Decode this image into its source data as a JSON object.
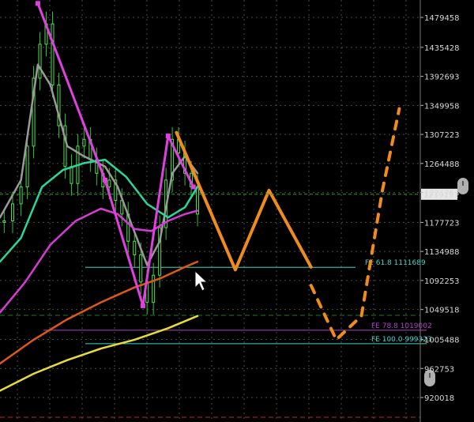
{
  "chart_data": {
    "type": "candlestick",
    "grid": true,
    "ylim": [
      900000,
      1520000
    ],
    "y_ticks": [
      {
        "label": "1479458",
        "value": 1479458
      },
      {
        "label": "1435428",
        "value": 1435428
      },
      {
        "label": "1392693",
        "value": 1392693
      },
      {
        "label": "1349958",
        "value": 1349958
      },
      {
        "label": "1307223",
        "value": 1307223
      },
      {
        "label": "1264488",
        "value": 1264488
      },
      {
        "label": "1221753",
        "value": 1221753
      },
      {
        "label": "1177723",
        "value": 1177723
      },
      {
        "label": "1134988",
        "value": 1134988
      },
      {
        "label": "1092253",
        "value": 1092253
      },
      {
        "label": "1049518",
        "value": 1049518
      },
      {
        "label": "1005488",
        "value": 1005488
      },
      {
        "label": "962753",
        "value": 962753
      },
      {
        "label": "920018",
        "value": 920018
      }
    ],
    "current_price": {
      "label": "1219151",
      "value": 1219151
    },
    "levels": [
      {
        "label": "FE 61.8 1111689",
        "value": 1111689,
        "color": "#3fd6c8"
      },
      {
        "label": "FE 78.8 1019002",
        "value": 1019002,
        "color": "#b040c8"
      },
      {
        "label": "FE 100.0 999323",
        "value": 999323,
        "color": "#3fd6c8"
      }
    ],
    "x_index_range": [
      0,
      100
    ],
    "candles": [
      {
        "x": 1,
        "close": 1180000
      },
      {
        "x": 3,
        "close": 1205000
      },
      {
        "x": 5,
        "close": 1230000
      },
      {
        "x": 6.5,
        "close": 1290000
      },
      {
        "x": 8,
        "close": 1390000
      },
      {
        "x": 9.5,
        "close": 1440000
      },
      {
        "x": 11,
        "close": 1470000
      },
      {
        "x": 12.5,
        "close": 1380000
      },
      {
        "x": 14,
        "close": 1320000
      },
      {
        "x": 15.5,
        "close": 1260000
      },
      {
        "x": 17,
        "close": 1235000
      },
      {
        "x": 18.5,
        "close": 1290000
      },
      {
        "x": 20,
        "close": 1300000
      },
      {
        "x": 21.5,
        "close": 1270000
      },
      {
        "x": 23,
        "close": 1250000
      },
      {
        "x": 24.5,
        "close": 1230000
      },
      {
        "x": 26,
        "close": 1240000
      },
      {
        "x": 27.5,
        "close": 1210000
      },
      {
        "x": 29,
        "close": 1190000
      },
      {
        "x": 30.5,
        "close": 1150000
      },
      {
        "x": 32,
        "close": 1130000
      },
      {
        "x": 33.5,
        "close": 1090000
      },
      {
        "x": 35,
        "close": 1060000
      },
      {
        "x": 36.5,
        "close": 1100000
      },
      {
        "x": 38,
        "close": 1170000
      },
      {
        "x": 39.5,
        "close": 1240000
      },
      {
        "x": 41,
        "close": 1300000
      },
      {
        "x": 42.5,
        "close": 1280000
      },
      {
        "x": 44,
        "close": 1250000
      },
      {
        "x": 45.5,
        "close": 1230000
      },
      {
        "x": 47,
        "close": 1190000
      }
    ],
    "series": [
      {
        "color": "#9a9a9a",
        "points": [
          [
            0,
            1185000
          ],
          [
            5,
            1240000
          ],
          [
            9,
            1410000
          ],
          [
            12,
            1380000
          ],
          [
            16,
            1290000
          ],
          [
            20,
            1275000
          ],
          [
            25,
            1260000
          ],
          [
            28,
            1230000
          ],
          [
            31,
            1180000
          ],
          [
            35,
            1115000
          ],
          [
            38,
            1150000
          ],
          [
            41,
            1250000
          ],
          [
            44,
            1275000
          ],
          [
            47,
            1250000
          ]
        ]
      },
      {
        "color": "#27d7a0",
        "points": [
          [
            0,
            1120000
          ],
          [
            5,
            1155000
          ],
          [
            10,
            1230000
          ],
          [
            15,
            1255000
          ],
          [
            20,
            1265000
          ],
          [
            25,
            1270000
          ],
          [
            30,
            1245000
          ],
          [
            35,
            1205000
          ],
          [
            40,
            1185000
          ],
          [
            44,
            1200000
          ],
          [
            47,
            1230000
          ]
        ]
      },
      {
        "color": "#d83ad8",
        "points": [
          [
            0,
            1045000
          ],
          [
            6,
            1090000
          ],
          [
            12,
            1145000
          ],
          [
            18,
            1180000
          ],
          [
            24,
            1198000
          ],
          [
            28,
            1190000
          ],
          [
            32,
            1168000
          ],
          [
            36,
            1165000
          ],
          [
            40,
            1180000
          ],
          [
            44,
            1190000
          ],
          [
            47,
            1195000
          ]
        ]
      },
      {
        "color": "#e0571a",
        "points": [
          [
            0,
            970000
          ],
          [
            8,
            1005000
          ],
          [
            16,
            1035000
          ],
          [
            24,
            1060000
          ],
          [
            32,
            1082000
          ],
          [
            38,
            1095000
          ],
          [
            44,
            1112000
          ],
          [
            47,
            1120000
          ]
        ]
      },
      {
        "color": "#e8dc3a",
        "points": [
          [
            0,
            930000
          ],
          [
            8,
            955000
          ],
          [
            16,
            975000
          ],
          [
            24,
            992000
          ],
          [
            32,
            1005000
          ],
          [
            40,
            1022000
          ],
          [
            47,
            1040000
          ]
        ]
      }
    ],
    "annotations": [
      {
        "color": "#e040e0",
        "points": [
          [
            9,
            1500000
          ],
          [
            25,
            1240000
          ],
          [
            34,
            1055000
          ],
          [
            40,
            1305000
          ],
          [
            46,
            1230000
          ]
        ]
      },
      {
        "color": "#f08c1e",
        "points": [
          [
            42,
            1310000
          ],
          [
            56,
            1108000
          ],
          [
            64,
            1225000
          ],
          [
            74,
            1112000
          ]
        ]
      },
      {
        "color": "#f08c1e",
        "dashed": true,
        "points": [
          [
            74,
            1085000
          ],
          [
            80,
            1005000
          ],
          [
            86,
            1040000
          ],
          [
            91,
            1225000
          ],
          [
            95,
            1345000
          ]
        ]
      }
    ]
  }
}
